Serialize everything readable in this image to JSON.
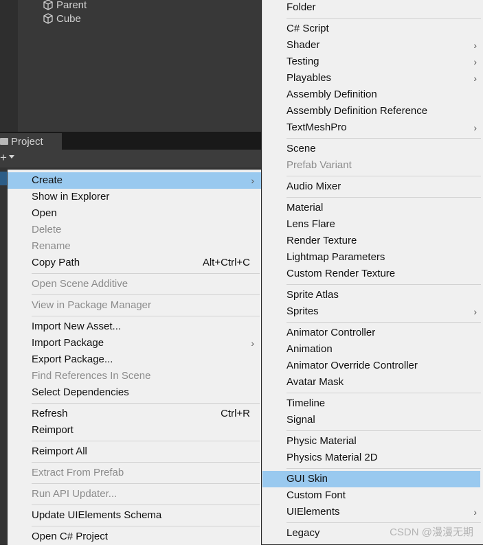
{
  "hierarchy": {
    "items": [
      "Parent",
      "Cube"
    ]
  },
  "project_panel": {
    "tab_label": "Project",
    "add_label": "+"
  },
  "context_menu": {
    "create": "Create",
    "show_in_explorer": "Show in Explorer",
    "open": "Open",
    "delete": "Delete",
    "rename": "Rename",
    "copy_path": "Copy Path",
    "copy_path_shortcut": "Alt+Ctrl+C",
    "open_scene_additive": "Open Scene Additive",
    "view_in_package_manager": "View in Package Manager",
    "import_new_asset": "Import New Asset...",
    "import_package": "Import Package",
    "export_package": "Export Package...",
    "find_references": "Find References In Scene",
    "select_dependencies": "Select Dependencies",
    "refresh": "Refresh",
    "refresh_shortcut": "Ctrl+R",
    "reimport": "Reimport",
    "reimport_all": "Reimport All",
    "extract_from_prefab": "Extract From Prefab",
    "run_api_updater": "Run API Updater...",
    "update_uielements_schema": "Update UIElements Schema",
    "open_csharp_project": "Open C# Project",
    "submenu_arrow": "›"
  },
  "create_submenu": {
    "folder": "Folder",
    "csharp_script": "C# Script",
    "shader": "Shader",
    "testing": "Testing",
    "playables": "Playables",
    "assembly_definition": "Assembly Definition",
    "assembly_definition_reference": "Assembly Definition Reference",
    "textmeshpro": "TextMeshPro",
    "scene": "Scene",
    "prefab_variant": "Prefab Variant",
    "audio_mixer": "Audio Mixer",
    "material": "Material",
    "lens_flare": "Lens Flare",
    "render_texture": "Render Texture",
    "lightmap_parameters": "Lightmap Parameters",
    "custom_render_texture": "Custom Render Texture",
    "sprite_atlas": "Sprite Atlas",
    "sprites": "Sprites",
    "animator_controller": "Animator Controller",
    "animation": "Animation",
    "animator_override_controller": "Animator Override Controller",
    "avatar_mask": "Avatar Mask",
    "timeline": "Timeline",
    "signal": "Signal",
    "physic_material": "Physic Material",
    "physics_material_2d": "Physics Material 2D",
    "gui_skin": "GUI Skin",
    "custom_font": "Custom Font",
    "uielements": "UIElements",
    "legacy": "Legacy"
  },
  "watermark": "CSDN @漫漫无期",
  "colors": {
    "highlight": "#99c9ef",
    "menu_bg": "#f0f0f0",
    "disabled_text": "#8c8c8c"
  }
}
